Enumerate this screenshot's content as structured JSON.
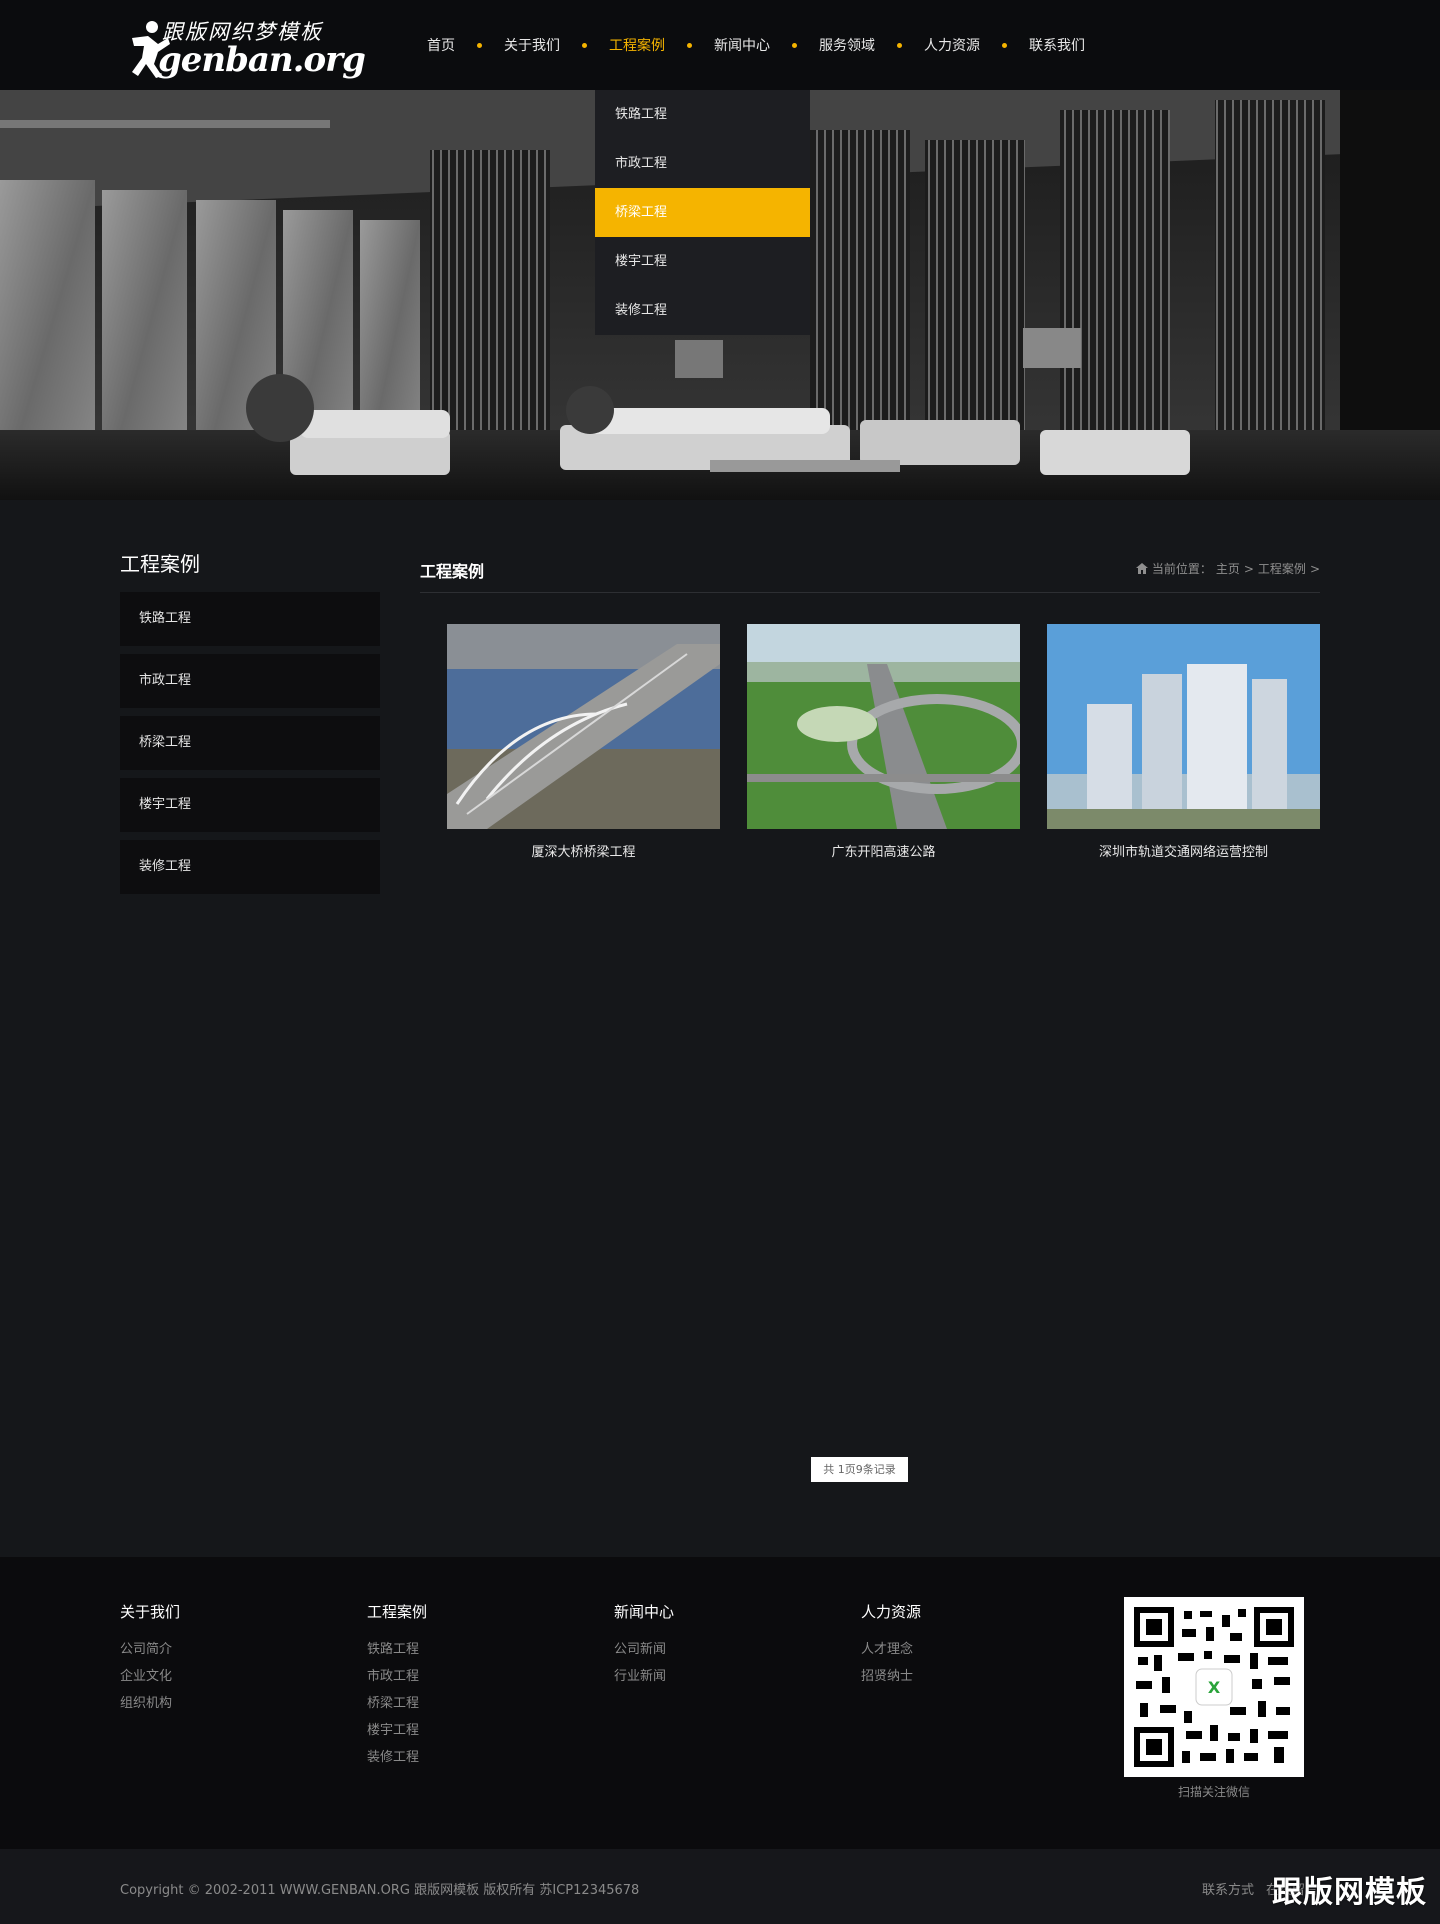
{
  "header": {
    "logo_cn": "跟版网织梦模板",
    "logo_en": "genban.org",
    "nav": [
      {
        "label": "首页",
        "active": false
      },
      {
        "label": "关于我们",
        "active": false
      },
      {
        "label": "工程案例",
        "active": true
      },
      {
        "label": "新闻中心",
        "active": false
      },
      {
        "label": "服务领域",
        "active": false
      },
      {
        "label": "人力资源",
        "active": false
      },
      {
        "label": "联系我们",
        "active": false
      }
    ],
    "accent_color": "#f5b400"
  },
  "dropdown": {
    "items": [
      "铁路工程",
      "市政工程",
      "桥梁工程",
      "楼宇工程",
      "装修工程"
    ],
    "active_index": 2
  },
  "sidebar": {
    "title": "工程案例",
    "items": [
      "铁路工程",
      "市政工程",
      "桥梁工程",
      "楼宇工程",
      "装修工程"
    ]
  },
  "main": {
    "title": "工程案例",
    "breadcrumb": {
      "prefix": "当前位置：",
      "home": "主页",
      "sep1": ">",
      "current": "工程案例",
      "sep2": ">"
    },
    "cases": [
      {
        "title": "厦深大桥桥梁工程"
      },
      {
        "title": "广东开阳高速公路"
      },
      {
        "title": "深圳市轨道交通网络运营控制"
      }
    ],
    "pagination": "共 1页9条记录"
  },
  "footer": {
    "columns": [
      {
        "title": "关于我们",
        "links": [
          "公司简介",
          "企业文化",
          "组织机构"
        ]
      },
      {
        "title": "工程案例",
        "links": [
          "铁路工程",
          "市政工程",
          "桥梁工程",
          "楼宇工程",
          "装修工程"
        ]
      },
      {
        "title": "新闻中心",
        "links": [
          "公司新闻",
          "行业新闻"
        ]
      },
      {
        "title": "人力资源",
        "links": [
          "人才理念",
          "招贤纳士"
        ]
      }
    ],
    "qr_caption": "扫描关注微信",
    "copyright": "Copyright © 2002-2011 WWW.GENBAN.ORG 跟版网模板 版权所有   苏ICP12345678",
    "bottom_links": [
      "联系方式",
      "在线留言"
    ],
    "watermark": "跟版网模板"
  }
}
